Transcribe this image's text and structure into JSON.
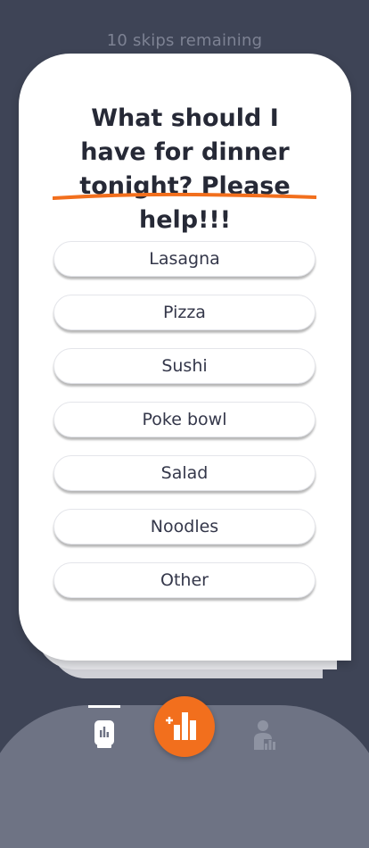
{
  "header": {
    "skips_text": "10 skips remaining"
  },
  "card": {
    "question": "What should I have for dinner tonight? Please help!!!",
    "options": [
      "Lasagna",
      "Pizza",
      "Sushi",
      "Poke bowl",
      "Salad",
      "Noodles",
      "Other"
    ]
  },
  "tab_bar": {
    "tabs": [
      {
        "icon": "feed-icon",
        "active": true
      },
      {
        "icon": "create-poll-icon",
        "active": false
      },
      {
        "icon": "profile-stats-icon",
        "active": false
      }
    ]
  },
  "colors": {
    "background": "#3e4456",
    "accent": "#f26f1d",
    "card": "#ffffff",
    "tab_bar": "#6e7384",
    "text_dark": "#262936"
  }
}
